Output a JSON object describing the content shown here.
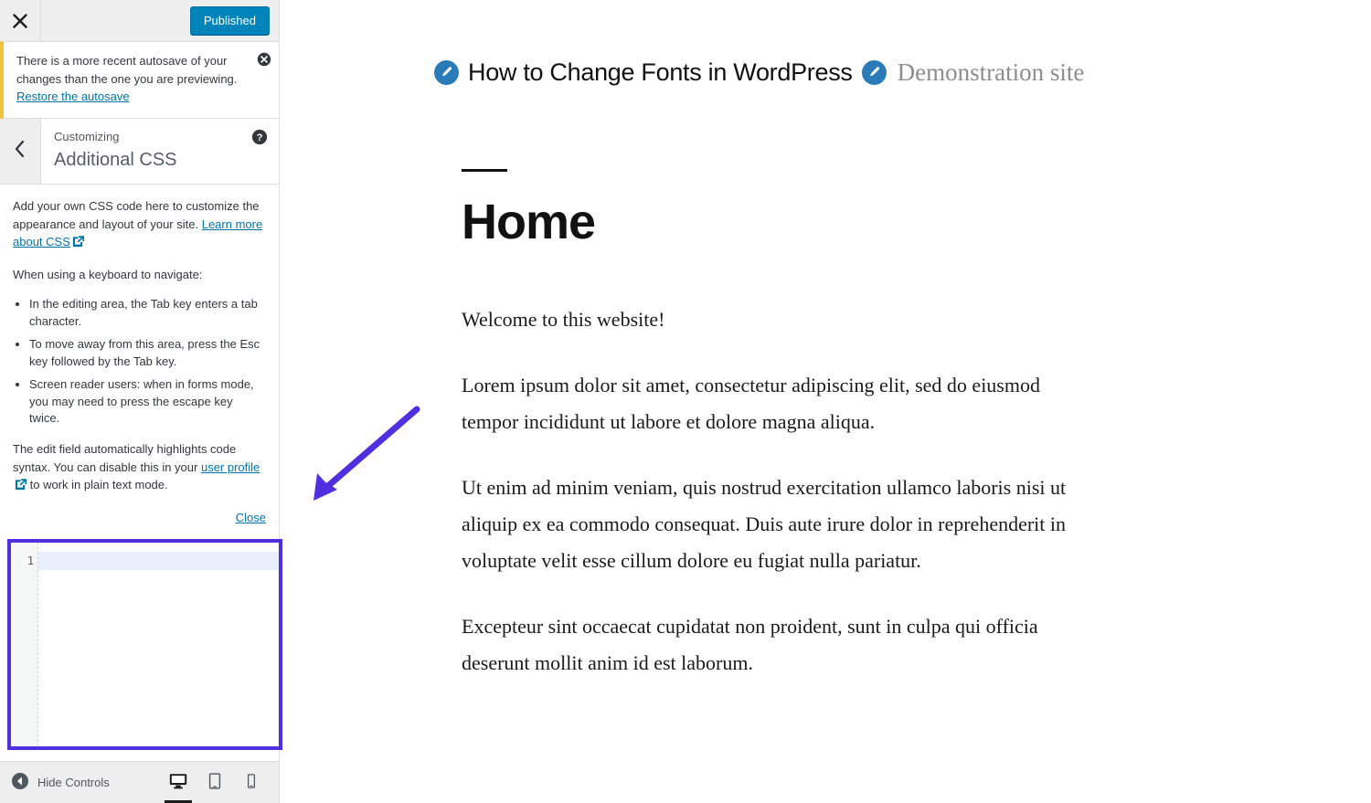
{
  "colors": {
    "accent_blue": "#0085ba",
    "link_blue": "#0073aa",
    "annotation_purple": "#4f2fe0",
    "notice_border": "#f0c33c",
    "sidebar_bg": "#eeeeee",
    "pencil_badge": "#2b7bb9"
  },
  "sidebar": {
    "header": {
      "close_icon": "close-icon",
      "publish_label": "Published"
    },
    "notice": {
      "text": "There is a more recent autosave of your changes than the one you are previewing.",
      "link_label": "Restore the autosave",
      "dismiss_icon": "dismiss-icon"
    },
    "panel": {
      "back_icon": "chevron-left-icon",
      "superlabel": "Customizing",
      "title": "Additional CSS",
      "help_icon": "help-icon"
    },
    "help": {
      "intro": "Add your own CSS code here to customize the appearance and layout of your site.",
      "intro_link": "Learn more about CSS",
      "keyboard_heading": "When using a keyboard to navigate:",
      "bullets": [
        "In the editing area, the Tab key enters a tab character.",
        "To move away from this area, press the Esc key followed by the Tab key.",
        "Screen reader users: when in forms mode, you may need to press the escape key twice."
      ],
      "syntax_part1": "The edit field automatically highlights code syntax. You can disable this in your ",
      "syntax_link": "user profile",
      "syntax_part2": " to work in plain text mode.",
      "close_label": "Close"
    },
    "editor": {
      "line_number": "1",
      "code_value": "",
      "placeholder": ""
    },
    "footer": {
      "hide_controls_label": "Hide Controls",
      "collapse_icon": "collapse-icon",
      "devices": [
        {
          "name": "desktop",
          "icon": "desktop-icon",
          "active": true
        },
        {
          "name": "tablet",
          "icon": "tablet-icon",
          "active": false
        },
        {
          "name": "mobile",
          "icon": "mobile-icon",
          "active": false
        }
      ]
    }
  },
  "preview": {
    "header": {
      "post_edit_icon": "edit-pencil-icon",
      "post_title": "How to Change Fonts in WordPress",
      "site_edit_icon": "edit-pencil-icon",
      "site_name": "Demonstration site"
    },
    "page": {
      "heading": "Home",
      "paragraphs": [
        "Welcome to this website!",
        "Lorem ipsum dolor sit amet, consectetur adipiscing elit, sed do eiusmod tempor incididunt ut labore et dolore magna aliqua.",
        "Ut enim ad minim veniam, quis nostrud exercitation ullamco laboris nisi ut aliquip ex ea commodo consequat. Duis aute irure dolor in reprehenderit in voluptate velit esse cillum dolore eu fugiat nulla pariatur.",
        "Excepteur sint occaecat cupidatat non proident, sunt in culpa qui officia deserunt mollit anim id est laborum."
      ]
    }
  },
  "annotations": {
    "arrow": {
      "name": "pointer-arrow",
      "color": "#4f2fe0"
    },
    "editor_highlight": {
      "name": "css-editor-highlight-box",
      "color": "#4f2fe0"
    }
  }
}
